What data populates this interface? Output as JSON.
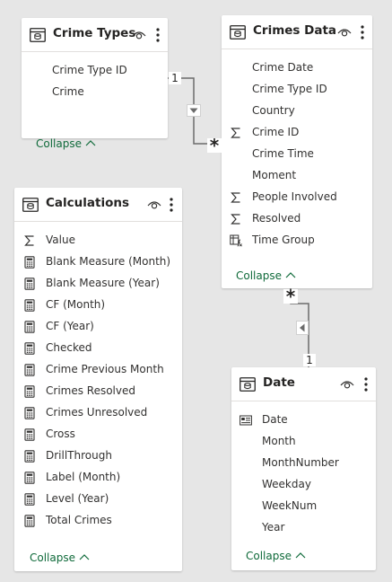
{
  "tables": {
    "crime_types": {
      "title": "Crime Types",
      "fields": [
        {
          "name": "Crime Type ID",
          "icon": "none-icon"
        },
        {
          "name": "Crime",
          "icon": "none-icon"
        }
      ],
      "collapse_label": "Collapse"
    },
    "crimes_data": {
      "title": "Crimes Data",
      "fields": [
        {
          "name": "Crime Date",
          "icon": "none-icon"
        },
        {
          "name": "Crime Type ID",
          "icon": "none-icon"
        },
        {
          "name": "Country",
          "icon": "none-icon"
        },
        {
          "name": "Crime ID",
          "icon": "sigma-icon"
        },
        {
          "name": "Crime Time",
          "icon": "none-icon"
        },
        {
          "name": "Moment",
          "icon": "none-icon"
        },
        {
          "name": "People Involved",
          "icon": "sigma-icon"
        },
        {
          "name": "Resolved",
          "icon": "sigma-icon"
        },
        {
          "name": "Time Group",
          "icon": "calculated-column-icon"
        }
      ],
      "collapse_label": "Collapse"
    },
    "calculations": {
      "title": "Calculations",
      "fields": [
        {
          "name": "Value",
          "icon": "sigma-icon"
        },
        {
          "name": "Blank Measure (Month)",
          "icon": "calculator-icon"
        },
        {
          "name": "Blank Measure (Year)",
          "icon": "calculator-icon"
        },
        {
          "name": "CF (Month)",
          "icon": "calculator-icon"
        },
        {
          "name": "CF (Year)",
          "icon": "calculator-icon"
        },
        {
          "name": "Checked",
          "icon": "calculator-icon"
        },
        {
          "name": "Crime Previous Month",
          "icon": "calculator-icon"
        },
        {
          "name": "Crimes Resolved",
          "icon": "calculator-icon"
        },
        {
          "name": "Crimes Unresolved",
          "icon": "calculator-icon"
        },
        {
          "name": "Cross",
          "icon": "calculator-icon"
        },
        {
          "name": "DrillThrough",
          "icon": "calculator-icon"
        },
        {
          "name": "Label (Month)",
          "icon": "calculator-icon"
        },
        {
          "name": "Level (Year)",
          "icon": "calculator-icon"
        },
        {
          "name": "Total Crimes",
          "icon": "calculator-icon"
        }
      ],
      "collapse_label": "Collapse"
    },
    "date": {
      "title": "Date",
      "fields": [
        {
          "name": "Date",
          "icon": "date-hierarchy-icon"
        },
        {
          "name": "Month",
          "icon": "none-icon"
        },
        {
          "name": "MonthNumber",
          "icon": "none-icon"
        },
        {
          "name": "Weekday",
          "icon": "none-icon"
        },
        {
          "name": "WeekNum",
          "icon": "none-icon"
        },
        {
          "name": "Year",
          "icon": "none-icon"
        }
      ],
      "collapse_label": "Collapse"
    }
  },
  "relationships": [
    {
      "from": "Crime Types",
      "to": "Crimes Data",
      "from_cardinality": "1",
      "to_cardinality": "*",
      "filter_direction": "down-arrow-icon"
    },
    {
      "from": "Date",
      "to": "Crimes Data",
      "from_cardinality": "1",
      "to_cardinality": "*",
      "filter_direction": "left-arrow-icon"
    }
  ],
  "colors": {
    "canvas_background": "#e6e6e6",
    "card_background": "#ffffff",
    "collapse_link": "#0f6a3a",
    "connector": "#6b6b6b",
    "text": "#252423"
  }
}
